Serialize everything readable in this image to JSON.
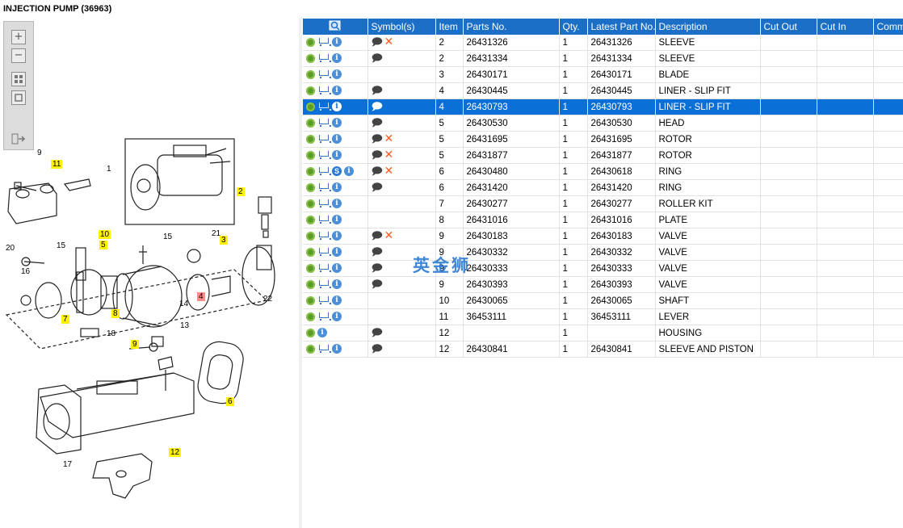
{
  "window": {
    "title": "INJECTION PUMP (36963)"
  },
  "toolbar": {
    "zoom_in": "+",
    "zoom_out": "−",
    "fit_icon": "fit-page-icon",
    "frame_icon": "frame-icon",
    "export_icon": "export-list-icon"
  },
  "callouts": [
    {
      "label": "9",
      "style": "plain"
    },
    {
      "label": "11",
      "style": "yellow"
    },
    {
      "label": "1",
      "style": "plain"
    },
    {
      "label": "2",
      "style": "yellow"
    },
    {
      "label": "20",
      "style": "plain"
    },
    {
      "label": "10",
      "style": "yellow"
    },
    {
      "label": "15",
      "style": "plain"
    },
    {
      "label": "15",
      "style": "plain"
    },
    {
      "label": "21",
      "style": "plain"
    },
    {
      "label": "3",
      "style": "yellow"
    },
    {
      "label": "5",
      "style": "yellow"
    },
    {
      "label": "16",
      "style": "plain"
    },
    {
      "label": "4",
      "style": "red"
    },
    {
      "label": "22",
      "style": "plain"
    },
    {
      "label": "14",
      "style": "plain"
    },
    {
      "label": "8",
      "style": "yellow"
    },
    {
      "label": "7",
      "style": "yellow"
    },
    {
      "label": "18",
      "style": "plain"
    },
    {
      "label": "13",
      "style": "plain"
    },
    {
      "label": "9",
      "style": "yellow"
    },
    {
      "label": "6",
      "style": "yellow"
    },
    {
      "label": "12",
      "style": "yellow"
    },
    {
      "label": "17",
      "style": "plain"
    }
  ],
  "table": {
    "headers": [
      "",
      "Symbol(s)",
      "Item",
      "Parts No.",
      "Qty.",
      "Latest Part No.",
      "Description",
      "Cut Out",
      "Cut In",
      "Comment"
    ],
    "rows": [
      {
        "item": "2",
        "part": "26431326",
        "qty": "1",
        "latest": "26431326",
        "desc": "SLEEVE",
        "bubble": true,
        "x": true,
        "cart": true,
        "s": false,
        "selected": false
      },
      {
        "item": "2",
        "part": "26431334",
        "qty": "1",
        "latest": "26431334",
        "desc": "SLEEVE",
        "bubble": true,
        "x": false,
        "cart": true,
        "s": false,
        "selected": false
      },
      {
        "item": "3",
        "part": "26430171",
        "qty": "1",
        "latest": "26430171",
        "desc": "BLADE",
        "bubble": false,
        "x": false,
        "cart": true,
        "s": false,
        "selected": false
      },
      {
        "item": "4",
        "part": "26430445",
        "qty": "1",
        "latest": "26430445",
        "desc": "LINER - SLIP FIT",
        "bubble": true,
        "x": false,
        "cart": true,
        "s": false,
        "selected": false
      },
      {
        "item": "4",
        "part": "26430793",
        "qty": "1",
        "latest": "26430793",
        "desc": "LINER - SLIP FIT",
        "bubble": true,
        "x": false,
        "cart": true,
        "s": false,
        "selected": true
      },
      {
        "item": "5",
        "part": "26430530",
        "qty": "1",
        "latest": "26430530",
        "desc": "HEAD",
        "bubble": true,
        "x": false,
        "cart": true,
        "s": false,
        "selected": false
      },
      {
        "item": "5",
        "part": "26431695",
        "qty": "1",
        "latest": "26431695",
        "desc": "ROTOR",
        "bubble": true,
        "x": true,
        "cart": true,
        "s": false,
        "selected": false
      },
      {
        "item": "5",
        "part": "26431877",
        "qty": "1",
        "latest": "26431877",
        "desc": "ROTOR",
        "bubble": true,
        "x": true,
        "cart": true,
        "s": false,
        "selected": false
      },
      {
        "item": "6",
        "part": "26430480",
        "qty": "1",
        "latest": "26430618",
        "desc": "RING",
        "bubble": true,
        "x": true,
        "cart": true,
        "s": true,
        "selected": false
      },
      {
        "item": "6",
        "part": "26431420",
        "qty": "1",
        "latest": "26431420",
        "desc": "RING",
        "bubble": true,
        "x": false,
        "cart": true,
        "s": false,
        "selected": false
      },
      {
        "item": "7",
        "part": "26430277",
        "qty": "1",
        "latest": "26430277",
        "desc": "ROLLER KIT",
        "bubble": false,
        "x": false,
        "cart": true,
        "s": false,
        "selected": false
      },
      {
        "item": "8",
        "part": "26431016",
        "qty": "1",
        "latest": "26431016",
        "desc": "PLATE",
        "bubble": false,
        "x": false,
        "cart": true,
        "s": false,
        "selected": false
      },
      {
        "item": "9",
        "part": "26430183",
        "qty": "1",
        "latest": "26430183",
        "desc": "VALVE",
        "bubble": true,
        "x": true,
        "cart": true,
        "s": false,
        "selected": false
      },
      {
        "item": "9",
        "part": "26430332",
        "qty": "1",
        "latest": "26430332",
        "desc": "VALVE",
        "bubble": true,
        "x": false,
        "cart": true,
        "s": false,
        "selected": false
      },
      {
        "item": "9",
        "part": "26430333",
        "qty": "1",
        "latest": "26430333",
        "desc": "VALVE",
        "bubble": true,
        "x": false,
        "cart": true,
        "s": false,
        "selected": false
      },
      {
        "item": "9",
        "part": "26430393",
        "qty": "1",
        "latest": "26430393",
        "desc": "VALVE",
        "bubble": true,
        "x": false,
        "cart": true,
        "s": false,
        "selected": false
      },
      {
        "item": "10",
        "part": "26430065",
        "qty": "1",
        "latest": "26430065",
        "desc": "SHAFT",
        "bubble": false,
        "x": false,
        "cart": true,
        "s": false,
        "selected": false
      },
      {
        "item": "11",
        "part": "36453111",
        "qty": "1",
        "latest": "36453111",
        "desc": "LEVER",
        "bubble": false,
        "x": false,
        "cart": true,
        "s": false,
        "selected": false
      },
      {
        "item": "12",
        "part": "",
        "qty": "1",
        "latest": "",
        "desc": "HOUSING",
        "bubble": true,
        "x": false,
        "cart": false,
        "s": false,
        "selected": false
      },
      {
        "item": "12",
        "part": "26430841",
        "qty": "1",
        "latest": "26430841",
        "desc": "SLEEVE AND PISTON",
        "bubble": true,
        "x": false,
        "cart": true,
        "s": false,
        "selected": false
      }
    ]
  },
  "watermark": "英金狮",
  "colors": {
    "header_bg": "#1c6fc7",
    "selected_row": "#0a6fd6",
    "callout_yellow": "#fff200",
    "callout_red": "#ff8a8a",
    "delete_x": "#ff5a1f"
  }
}
